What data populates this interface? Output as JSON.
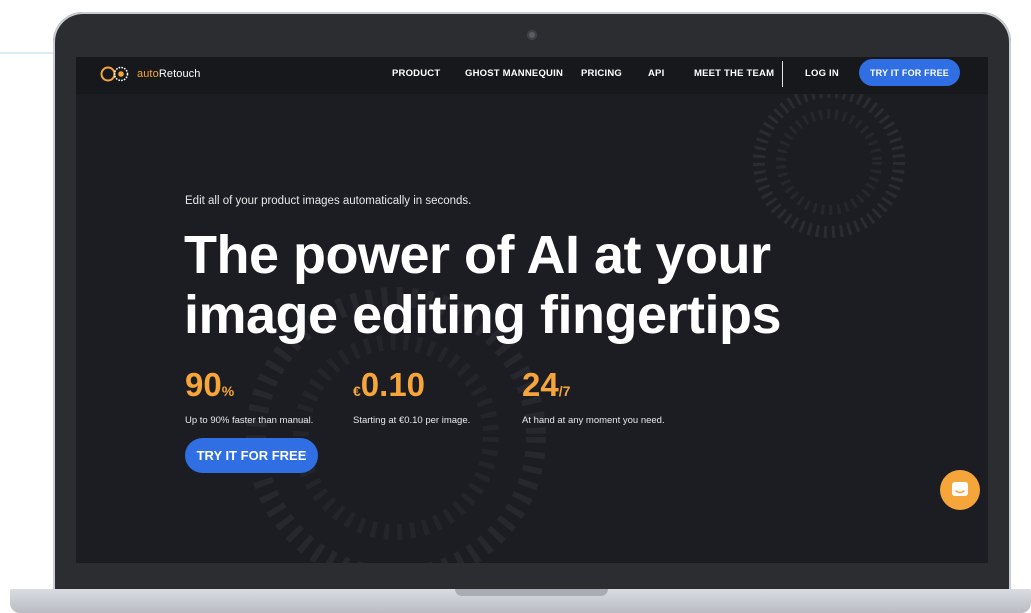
{
  "brand": {
    "name_prefix": "auto",
    "name_suffix": "Retouch",
    "accent_color": "#f5a53a",
    "primary_color": "#2f6fe3",
    "logo_icon": "autoretouch-logo-icon"
  },
  "nav": {
    "items": [
      {
        "label": "PRODUCT"
      },
      {
        "label": "GHOST MANNEQUIN"
      },
      {
        "label": "PRICING"
      },
      {
        "label": "API"
      },
      {
        "label": "MEET THE TEAM"
      }
    ],
    "login_label": "LOG IN",
    "cta_label": "TRY IT FOR FREE"
  },
  "hero": {
    "tagline": "Edit all of your product images automatically in seconds.",
    "headline_line1": "The power of AI at your",
    "headline_line2": "image editing fingertips",
    "stats": [
      {
        "prefix": "",
        "value": "90",
        "suffix": "%",
        "description": "Up to 90% faster than manual."
      },
      {
        "prefix": "€",
        "value": "0.10",
        "suffix": "",
        "description": "Starting at €0.10 per image."
      },
      {
        "prefix": "",
        "value": "24",
        "suffix": "/7",
        "description": "At hand at any moment you need."
      }
    ],
    "cta_label": "TRY IT FOR FREE"
  },
  "chat": {
    "icon": "chat-icon"
  }
}
